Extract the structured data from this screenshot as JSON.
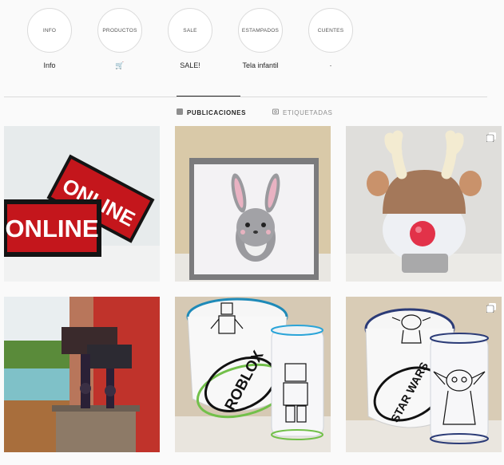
{
  "highlights": [
    {
      "cover": "INFO",
      "label": "Info"
    },
    {
      "cover": "PRODUCTOS",
      "label": "🛒"
    },
    {
      "cover": "SALE",
      "label": "SALE!"
    },
    {
      "cover": "ESTAMPADOS",
      "label": "Tela infantil"
    },
    {
      "cover": "CUENTES",
      "label": "·"
    }
  ],
  "tabs": {
    "posts": "PUBLICACIONES",
    "tagged": "ETIQUETADAS"
  },
  "posts": {
    "online_signs": {
      "word": "ONLINE",
      "word2": "ONLINE"
    },
    "roblox_lamp": {
      "drum_text": "ROBLOX"
    },
    "yoda_lamp": {
      "drum_text": "STAR WARS"
    }
  },
  "colors": {
    "accent": "#262626",
    "border": "#dbdbdb",
    "muted": "#8e8e8e",
    "sign_red": "#c4161c"
  },
  "icons": [
    "grid-icon",
    "tag-icon",
    "multiple-photos-icon"
  ]
}
